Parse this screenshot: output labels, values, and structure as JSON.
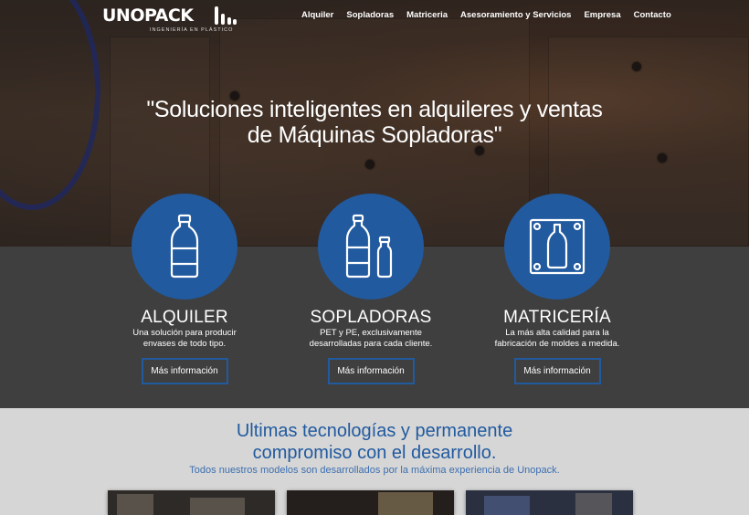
{
  "brand": {
    "name": "UNOPACK",
    "tagline": "INGENIERÍA EN PLÁSTICO"
  },
  "nav": {
    "items": [
      {
        "label": "Alquiler"
      },
      {
        "label": "Sopladoras"
      },
      {
        "label": "Matriceria"
      },
      {
        "label": "Asesoramiento y Servicios"
      },
      {
        "label": "Empresa"
      },
      {
        "label": "Contacto"
      }
    ]
  },
  "hero": {
    "line1": "\"Soluciones inteligentes en alquileres y ventas",
    "line2": "de Máquinas Sopladoras\""
  },
  "features": [
    {
      "title": "ALQUILER",
      "desc1": "Una solución para producir",
      "desc2": "envases de todo tipo.",
      "button": "Más información",
      "icon": "bottle-icon"
    },
    {
      "title": "SOPLADORAS",
      "desc1": "PET y PE, exclusivamente",
      "desc2": "desarrolladas para cada cliente.",
      "button": "Más información",
      "icon": "bottles-icon"
    },
    {
      "title": "MATRICERÍA",
      "desc1": "La más alta calidad para la",
      "desc2": "fabricación de moldes a medida.",
      "button": "Más información",
      "icon": "mold-icon"
    }
  ],
  "section": {
    "title1": "Ultimas tecnologías y permanente",
    "title2": "compromiso con el desarrollo.",
    "subtitle": "Todos nuestros modelos son desarrollados por la máxima experiencia de Unopack."
  },
  "colors": {
    "accent": "#215a9f",
    "band": "#3f3f3f",
    "light_bg": "#d6d6d6"
  }
}
